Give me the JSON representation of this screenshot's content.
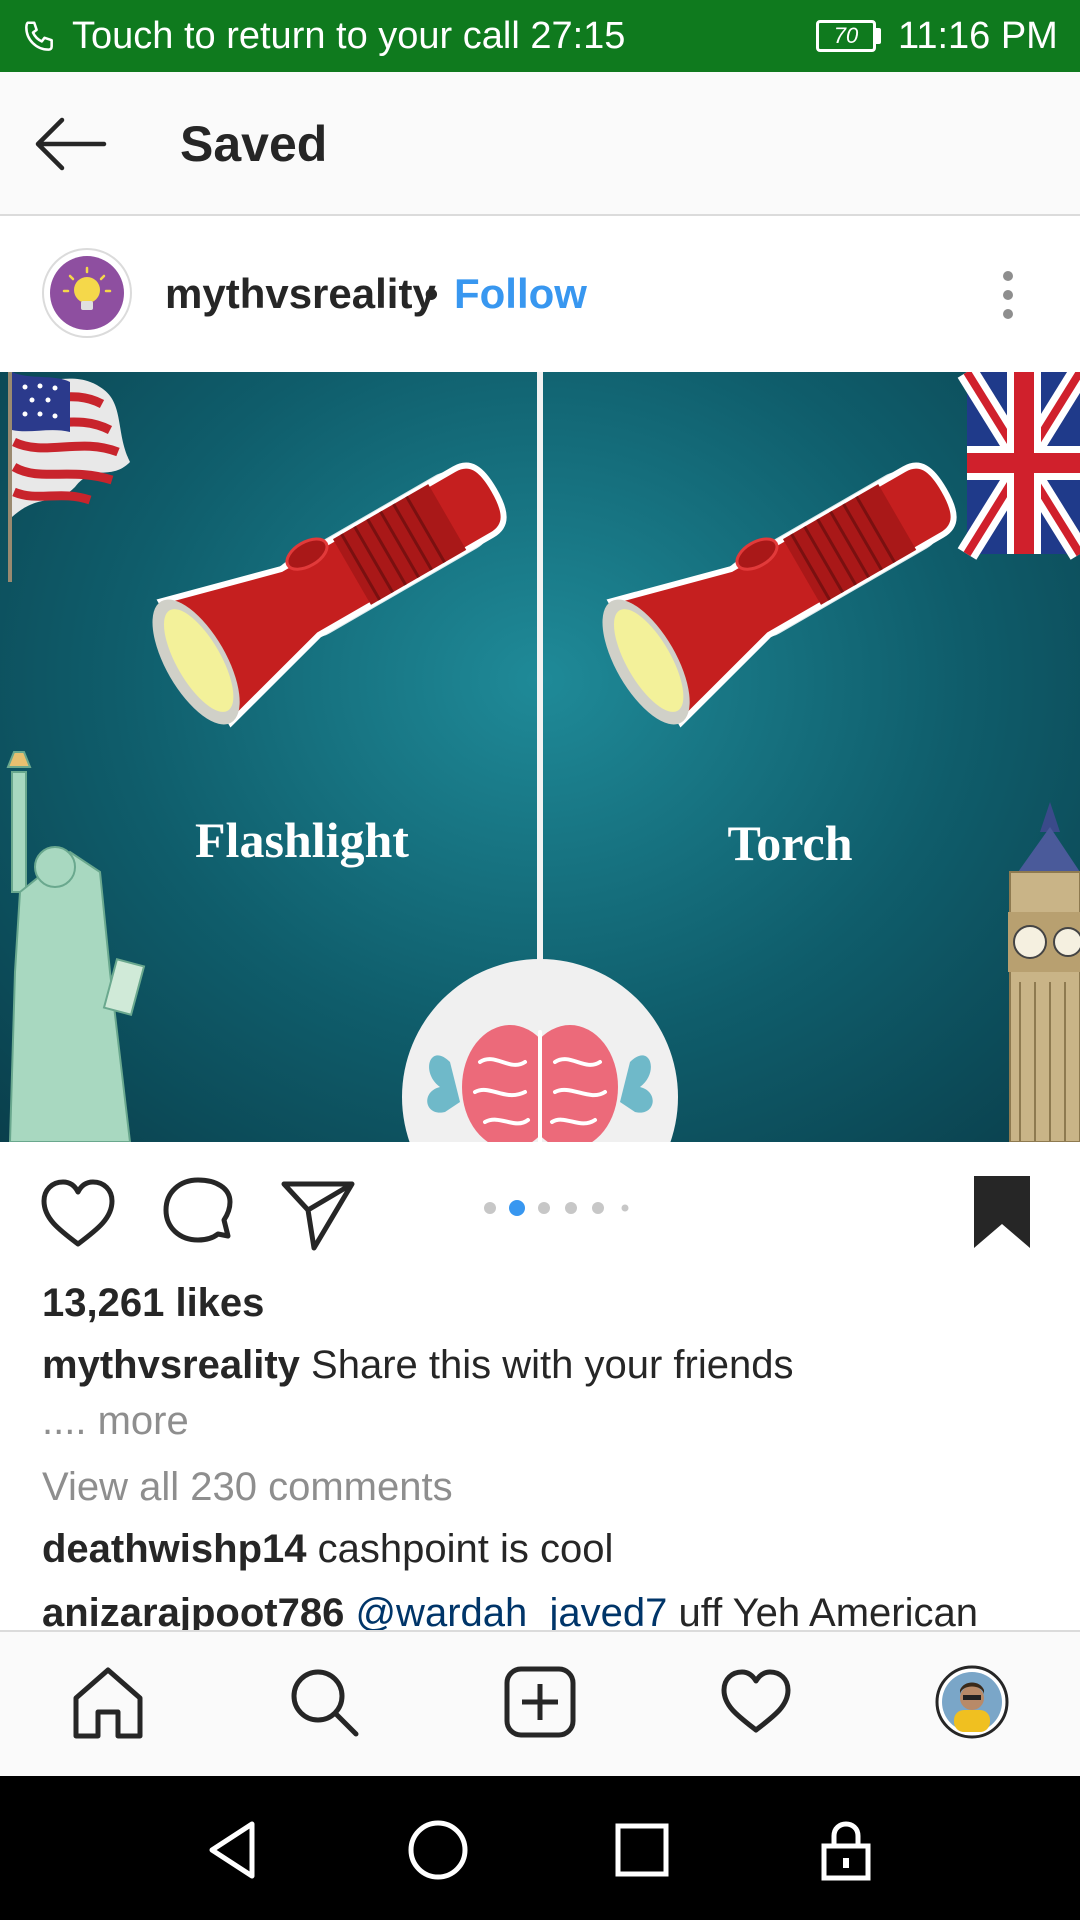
{
  "status_bar": {
    "call_text": "Touch to return to your call 27:15",
    "battery": "70",
    "time": "11:16 PM"
  },
  "header": {
    "title": "Saved"
  },
  "post": {
    "username": "mythvsreality",
    "separator": "•",
    "follow_label": "Follow",
    "image": {
      "left_label": "Flashlight",
      "right_label": "Torch"
    },
    "carousel": {
      "count": 6,
      "active_index": 1
    },
    "likes": "13,261 likes",
    "caption": {
      "username": "mythvsreality",
      "text": "Share this with your friends",
      "more": ".... more"
    },
    "view_all_comments": "View all 230 comments",
    "comments": [
      {
        "username": "deathwishp14",
        "text": "cashpoint is cool"
      },
      {
        "username": "anizarajpoot786",
        "mention": "@wardah_javed7",
        "text": "uff Yeh American"
      }
    ]
  },
  "icons": {
    "action_row": [
      "heart-icon",
      "comment-icon",
      "share-icon",
      "bookmark-icon"
    ],
    "bottom_nav": [
      "home-icon",
      "search-icon",
      "add-post-icon",
      "activity-heart-icon",
      "profile-avatar"
    ],
    "system_nav": [
      "back-icon",
      "home-circle-icon",
      "recents-icon",
      "lock-icon"
    ]
  },
  "colors": {
    "status_bar": "#0f7a1e",
    "follow": "#3897f0",
    "mention": "#003569",
    "muted": "#8e8e8e"
  }
}
